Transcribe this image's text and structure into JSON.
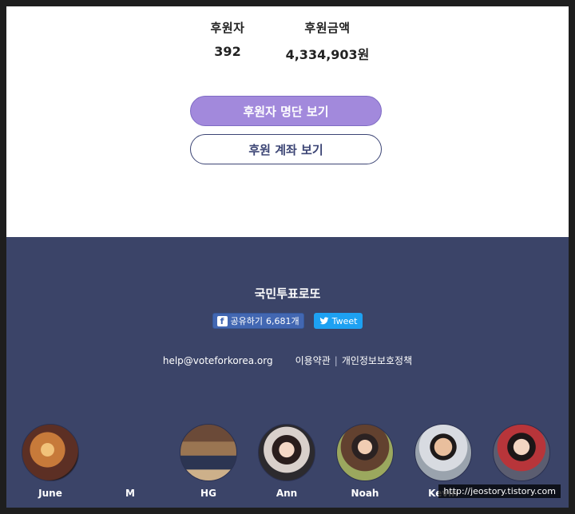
{
  "stats": {
    "donors_label": "후원자",
    "donors_value": "392",
    "amount_label": "후원금액",
    "amount_value": "4,334,903원"
  },
  "buttons": {
    "donor_list": "후원자 명단 보기",
    "account": "후원 계좌 보기"
  },
  "footer": {
    "brand": "국민투표로또",
    "facebook_label": "공유하기",
    "facebook_count": "6,681개",
    "tweet_label": "Tweet",
    "email": "help@voteforkorea.org",
    "terms": "이용약관",
    "privacy": "개인정보보호정책",
    "separator": "|"
  },
  "team": [
    {
      "name": "June"
    },
    {
      "name": "M"
    },
    {
      "name": "HG"
    },
    {
      "name": "Ann"
    },
    {
      "name": "Noah"
    },
    {
      "name": "Kevin"
    },
    {
      "name": ""
    }
  ],
  "watermark": "http://jeostory.tistory.com",
  "colors": {
    "primary_button": "#a289dc",
    "outline_button": "#3c4575",
    "footer_bg": "#3b4468",
    "facebook": "#4267b2",
    "twitter": "#1da1f2"
  }
}
